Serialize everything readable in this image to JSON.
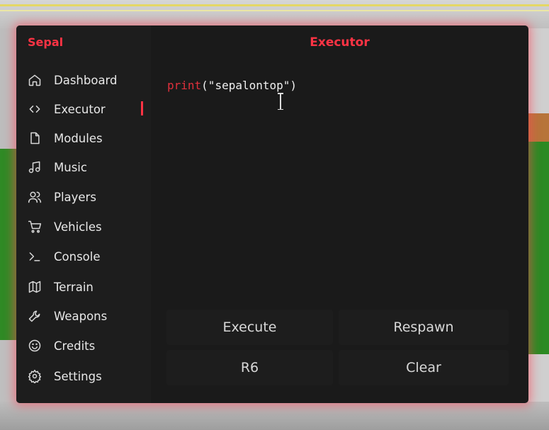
{
  "app": {
    "brand": "Sepal",
    "page_title": "Executor"
  },
  "sidebar": {
    "items": [
      {
        "label": "Dashboard",
        "icon": "home-icon"
      },
      {
        "label": "Executor",
        "icon": "code-icon",
        "active": true
      },
      {
        "label": "Modules",
        "icon": "file-icon"
      },
      {
        "label": "Music",
        "icon": "music-icon"
      },
      {
        "label": "Players",
        "icon": "users-icon"
      },
      {
        "label": "Vehicles",
        "icon": "cart-icon"
      },
      {
        "label": "Console",
        "icon": "terminal-icon"
      },
      {
        "label": "Terrain",
        "icon": "map-icon"
      },
      {
        "label": "Weapons",
        "icon": "wrench-icon"
      },
      {
        "label": "Credits",
        "icon": "smile-icon"
      },
      {
        "label": "Settings",
        "icon": "gear-icon"
      }
    ]
  },
  "editor": {
    "keyword": "print",
    "code_rest": "(\"sepalontop\")"
  },
  "actions": {
    "execute": "Execute",
    "respawn": "Respawn",
    "r6": "R6",
    "clear": "Clear"
  },
  "colors": {
    "accent": "#ff3344",
    "window_bg": "#1a1a1a",
    "sidebar_bg": "#1d1d1d"
  }
}
